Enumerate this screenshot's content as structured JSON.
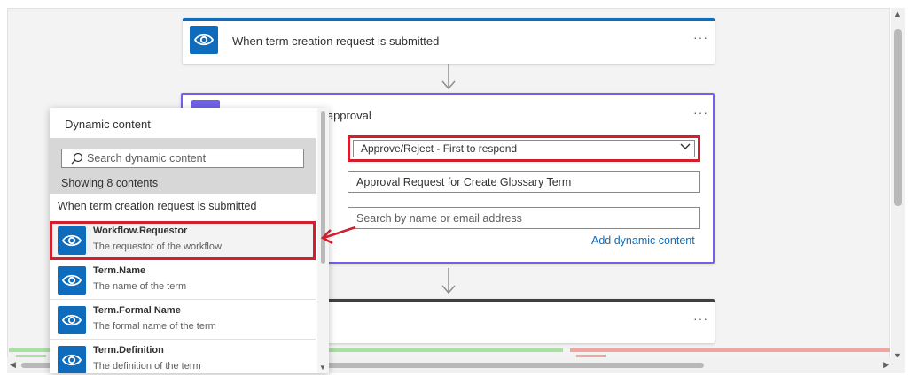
{
  "trigger": {
    "title": "When term creation request is submitted",
    "icon": "eye-icon",
    "more": "···"
  },
  "approval": {
    "title_visible": "n approval",
    "more": "···",
    "approval_type": "Approve/Reject - First to respond",
    "title_value": "Approval Request for Create Glossary Term",
    "assigned_placeholder": "Search by name or email address",
    "add_dynamic_content": "Add dynamic content"
  },
  "third_step": {
    "more": "···"
  },
  "dynamic_panel": {
    "header": "Dynamic content",
    "search_placeholder": "Search dynamic content",
    "count_text": "Showing 8 contents",
    "section_label": "When term creation request is submitted",
    "items": [
      {
        "name": "Workflow.Requestor",
        "description": "The requestor of the workflow",
        "selected": true
      },
      {
        "name": "Term.Name",
        "description": "The name of the term",
        "selected": false
      },
      {
        "name": "Term.Formal Name",
        "description": "The formal name of the term",
        "selected": false
      },
      {
        "name": "Term.Definition",
        "description": "The definition of the term",
        "selected": false
      }
    ]
  },
  "colors": {
    "accent_blue": "#0f6cbd",
    "approval_purple": "#7160e8",
    "highlight_red": "#d21f2e",
    "branch_green": "#a7e0a0",
    "branch_red": "#f0a4a0"
  }
}
